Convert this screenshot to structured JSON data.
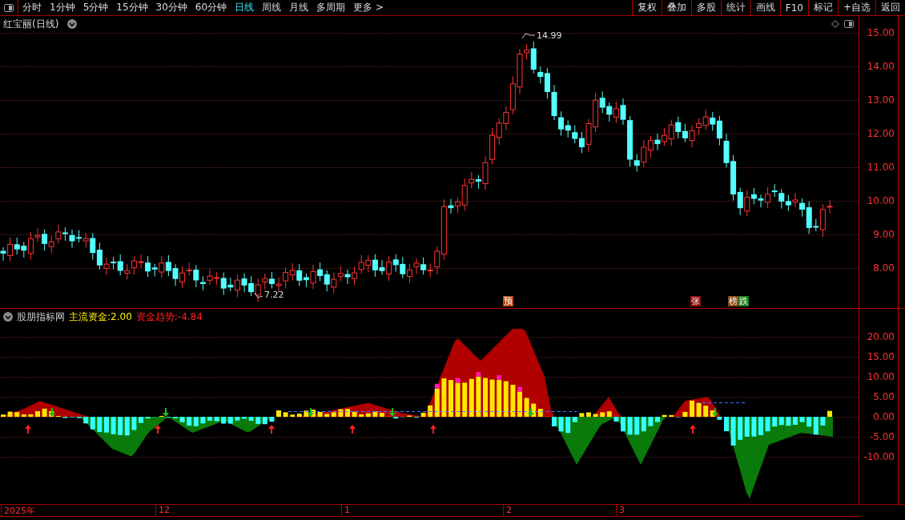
{
  "toolbar": {
    "periods": [
      {
        "label": "分时",
        "selected": false
      },
      {
        "label": "1分钟",
        "selected": false
      },
      {
        "label": "5分钟",
        "selected": false
      },
      {
        "label": "15分钟",
        "selected": false
      },
      {
        "label": "30分钟",
        "selected": false
      },
      {
        "label": "60分钟",
        "selected": false
      },
      {
        "label": "日线",
        "selected": true
      },
      {
        "label": "周线",
        "selected": false
      },
      {
        "label": "月线",
        "selected": false
      },
      {
        "label": "多周期",
        "selected": false
      }
    ],
    "more": "更多 >",
    "buttons": [
      "复权",
      "叠加",
      "多股",
      "统计",
      "画线",
      "F10",
      "标记",
      "+自选",
      "返回"
    ]
  },
  "main_panel": {
    "title": "红宝丽(日线)",
    "high_label": "14.99",
    "low_label": "7.22",
    "markers": [
      {
        "text": "预",
        "color": "#b8470f"
      },
      {
        "text": "张",
        "color": "#8b0a0a"
      },
      {
        "text": "榜",
        "color": "#8b4513"
      },
      {
        "text": "跌",
        "color": "#1a7f1a"
      }
    ],
    "yticks": [
      "15.00",
      "14.00",
      "13.00",
      "12.00",
      "11.00",
      "10.00",
      "9.00",
      "8.00"
    ]
  },
  "indicator_panel": {
    "name": "股朋指标网",
    "series": [
      {
        "label": "主流资金:",
        "value": "2.00"
      },
      {
        "label": "资金趋势:",
        "value": "-4.84"
      }
    ],
    "yticks": [
      "20.00",
      "15.00",
      "10.00",
      "5.00",
      "0.00",
      "-5.00",
      "-10.00"
    ]
  },
  "time_axis": [
    "2025年",
    "12",
    "1",
    "2",
    "3"
  ]
}
